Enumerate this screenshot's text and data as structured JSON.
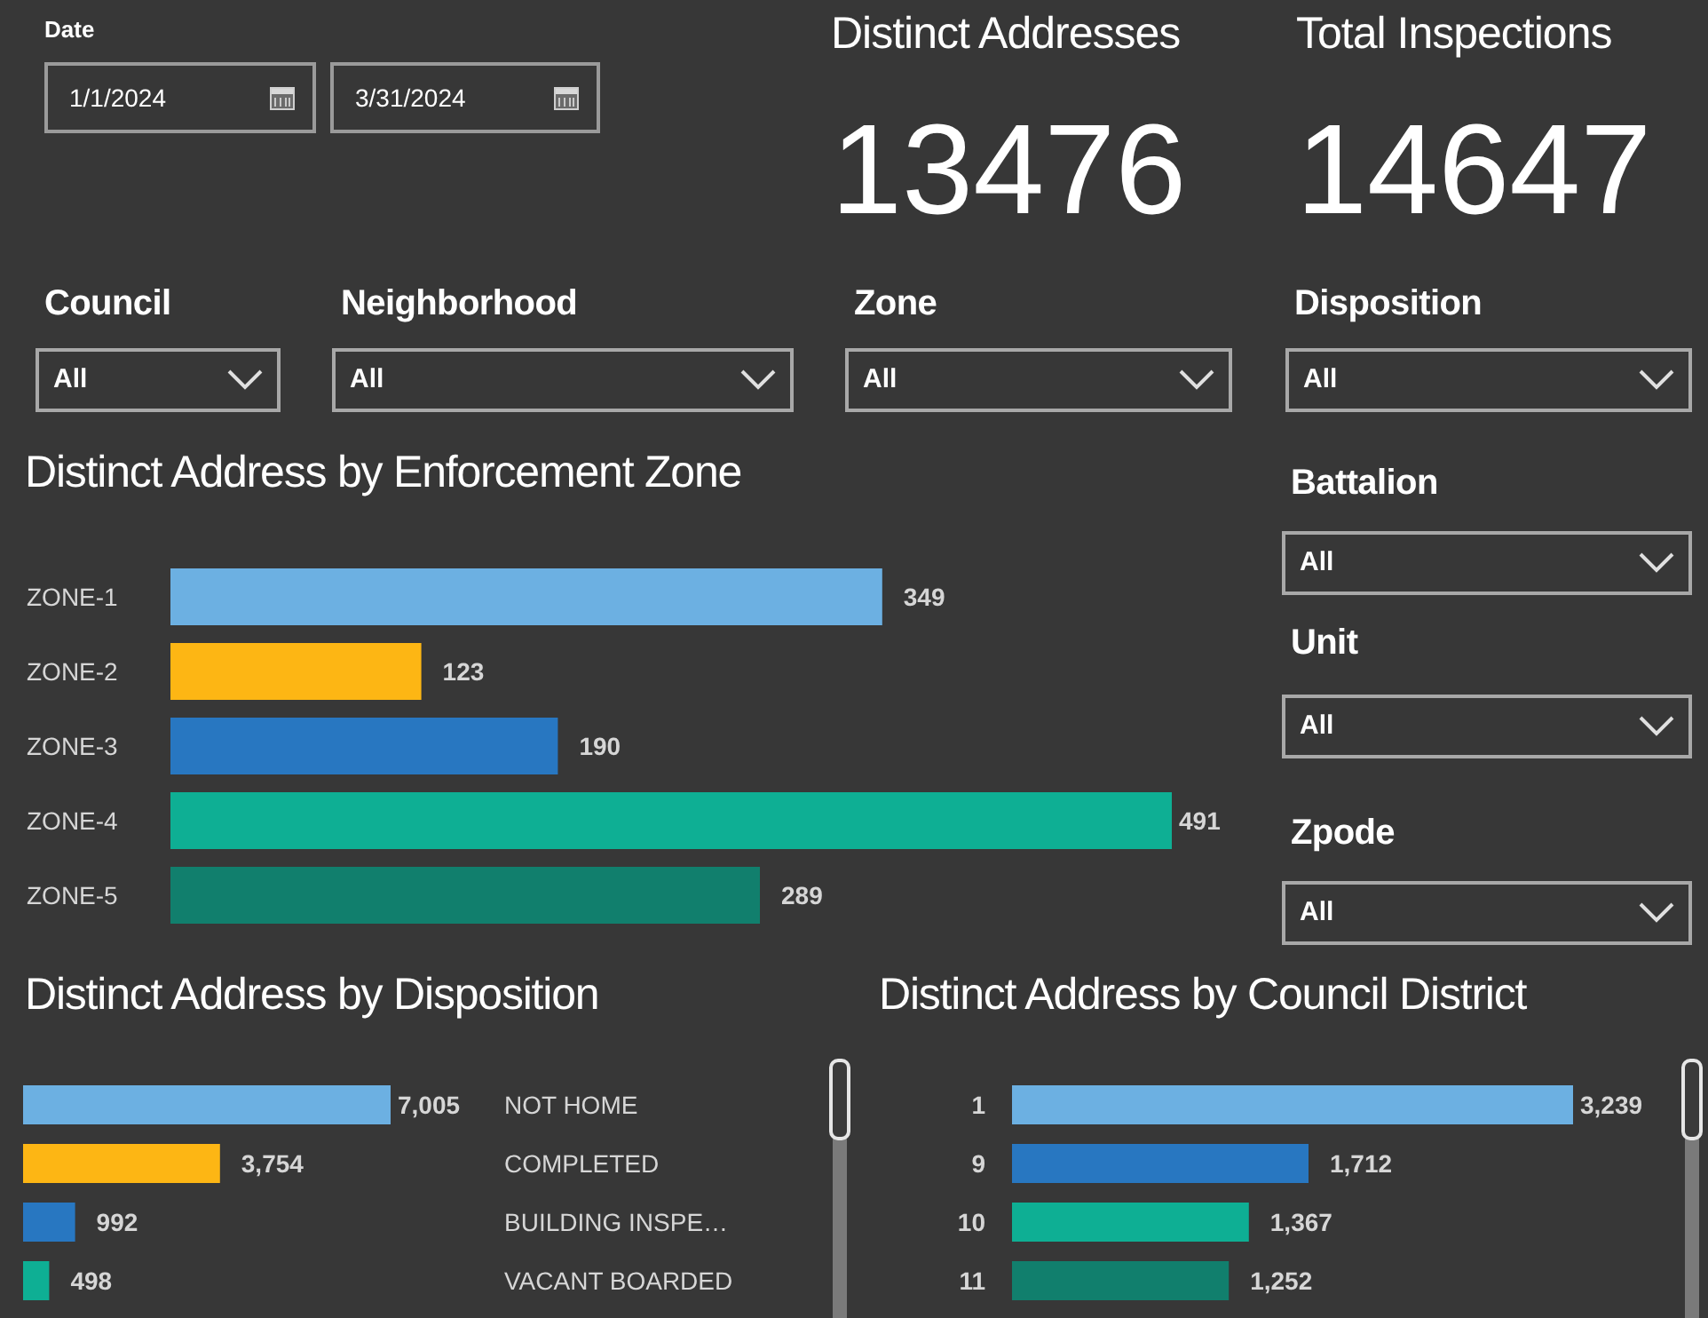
{
  "date_slicer": {
    "label": "Date",
    "start": "1/1/2024",
    "end": "3/31/2024"
  },
  "cards": [
    {
      "title": "Distinct Addresses",
      "value": "13476"
    },
    {
      "title": "Total Inspections",
      "value": "14647"
    }
  ],
  "slicers": [
    {
      "label": "Council",
      "value": "All"
    },
    {
      "label": "Neighborhood",
      "value": "All"
    },
    {
      "label": "Zone",
      "value": "All"
    },
    {
      "label": "Disposition",
      "value": "All"
    },
    {
      "label": "Battalion",
      "value": "All"
    },
    {
      "label": "Unit",
      "value": "All"
    },
    {
      "label": "Zpode",
      "value": "All"
    }
  ],
  "charts": [
    {
      "chart_data": {
        "type": "bar",
        "orientation": "horizontal",
        "title": "Distinct Address by Enforcement Zone",
        "categories": [
          "ZONE-1",
          "ZONE-2",
          "ZONE-3",
          "ZONE-4",
          "ZONE-5"
        ],
        "values": [
          349,
          123,
          190,
          491,
          289
        ],
        "data_labels": true
      }
    },
    {
      "chart_data": {
        "type": "bar",
        "orientation": "horizontal",
        "title": "Distinct Address by Disposition",
        "categories": [
          "NOT HOME",
          "COMPLETED",
          "BUILDING INSPE…",
          "VACANT BOARDED"
        ],
        "values": [
          7005,
          3754,
          992,
          498
        ],
        "value_labels": [
          "7,005",
          "3,754",
          "992",
          "498"
        ]
      }
    },
    {
      "chart_data": {
        "type": "bar",
        "orientation": "horizontal",
        "title": "Distinct Address by Council District",
        "categories": [
          "1",
          "9",
          "10",
          "11"
        ],
        "values": [
          3239,
          1712,
          1367,
          1252
        ],
        "value_labels": [
          "3,239",
          "1,712",
          "1,367",
          "1,252"
        ]
      }
    }
  ]
}
